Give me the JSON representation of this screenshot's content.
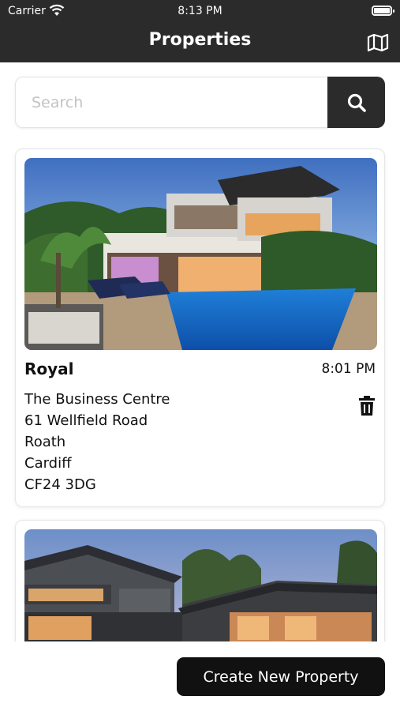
{
  "status_bar": {
    "carrier": "Carrier",
    "time": "8:13 PM"
  },
  "header": {
    "title": "Properties",
    "map_icon": "map-icon"
  },
  "search": {
    "placeholder": "Search",
    "value": "",
    "icon": "search-icon"
  },
  "properties": [
    {
      "name": "Royal",
      "time": "8:01 PM",
      "address": [
        "The Business Centre",
        "61 Wellfield Road",
        "Roath",
        "Cardiff",
        "CF24 3DG"
      ],
      "photo": "modern-villa-with-pool-photo",
      "delete_icon": "trash-icon"
    },
    {
      "photo": "large-house-at-dusk-photo"
    }
  ],
  "footer": {
    "create_label": "Create New Property"
  },
  "colors": {
    "header_bg": "#2b2b2b",
    "button_bg": "#111111",
    "card_border": "#e6e6e6"
  }
}
